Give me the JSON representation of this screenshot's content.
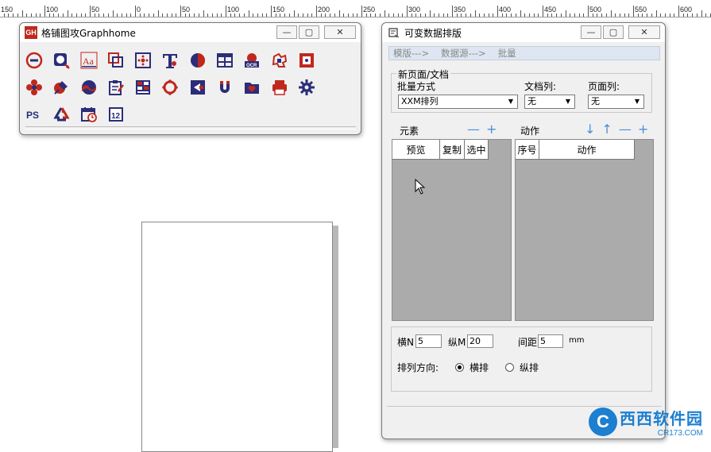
{
  "ruler": {
    "labels": [
      "150",
      "100",
      "50",
      "0",
      "50",
      "100",
      "150",
      "200",
      "250",
      "300",
      "350",
      "400",
      "450",
      "500",
      "550",
      "600"
    ]
  },
  "toolbar_window": {
    "title": "格铺图攻Graphhome",
    "app_icon_text": "GH",
    "tools": [
      {
        "name": "no-entry-icon"
      },
      {
        "name": "magnifier-add-icon"
      },
      {
        "name": "text-aa-icon"
      },
      {
        "name": "overlap-squares-icon"
      },
      {
        "name": "target-dots-icon"
      },
      {
        "name": "text-t-icon"
      },
      {
        "name": "half-circle-icon"
      },
      {
        "name": "table-icon"
      },
      {
        "name": "ocr-icon"
      },
      {
        "name": "puzzle-icon"
      },
      {
        "name": "dots-square-icon"
      },
      {
        "name": "flower-icon"
      },
      {
        "name": "pen-nib-icon"
      },
      {
        "name": "wave-circle-icon"
      },
      {
        "name": "clipboard-edit-icon"
      },
      {
        "name": "grid-blocks-icon"
      },
      {
        "name": "ring-icon"
      },
      {
        "name": "arrow-box-icon"
      },
      {
        "name": "magnet-icon"
      },
      {
        "name": "heart-folder-icon"
      },
      {
        "name": "printer-icon"
      },
      {
        "name": "gear-icon"
      },
      {
        "name": "ps-icon"
      },
      {
        "name": "recycle-icon"
      },
      {
        "name": "calendar-clock-icon"
      },
      {
        "name": "page-number-icon"
      }
    ],
    "ocr_label": "OCR",
    "text_aa": "Aa",
    "ps_label": "PS",
    "page_num": "12"
  },
  "var_window": {
    "title": "可变数据排版",
    "menu": [
      "模版--->",
      "数据源--->",
      "批量"
    ],
    "group_title": "新页面/文档",
    "batch_mode_label": "批量方式",
    "batch_mode_value": "XXM排列",
    "doc_col_label": "文档列:",
    "doc_col_value": "无",
    "page_col_label": "页面列:",
    "page_col_value": "无",
    "elements_label": "元素",
    "actions_label": "动作",
    "elements_headers": [
      "预览",
      "复制",
      "选中"
    ],
    "actions_headers": [
      "序号",
      "动作"
    ],
    "horizontal_label": "横N",
    "horizontal_value": "5",
    "vertical_label": "纵M",
    "vertical_value": "20",
    "spacing_label": "间距",
    "spacing_value": "5",
    "unit": "mm",
    "direction_label": "排列方向:",
    "direction_options": [
      "横排",
      "纵排"
    ],
    "direction_selected": "横排"
  },
  "watermark": {
    "logo_letter": "C",
    "main_text": "西西软件园",
    "sub_text": "CR173.COM"
  }
}
